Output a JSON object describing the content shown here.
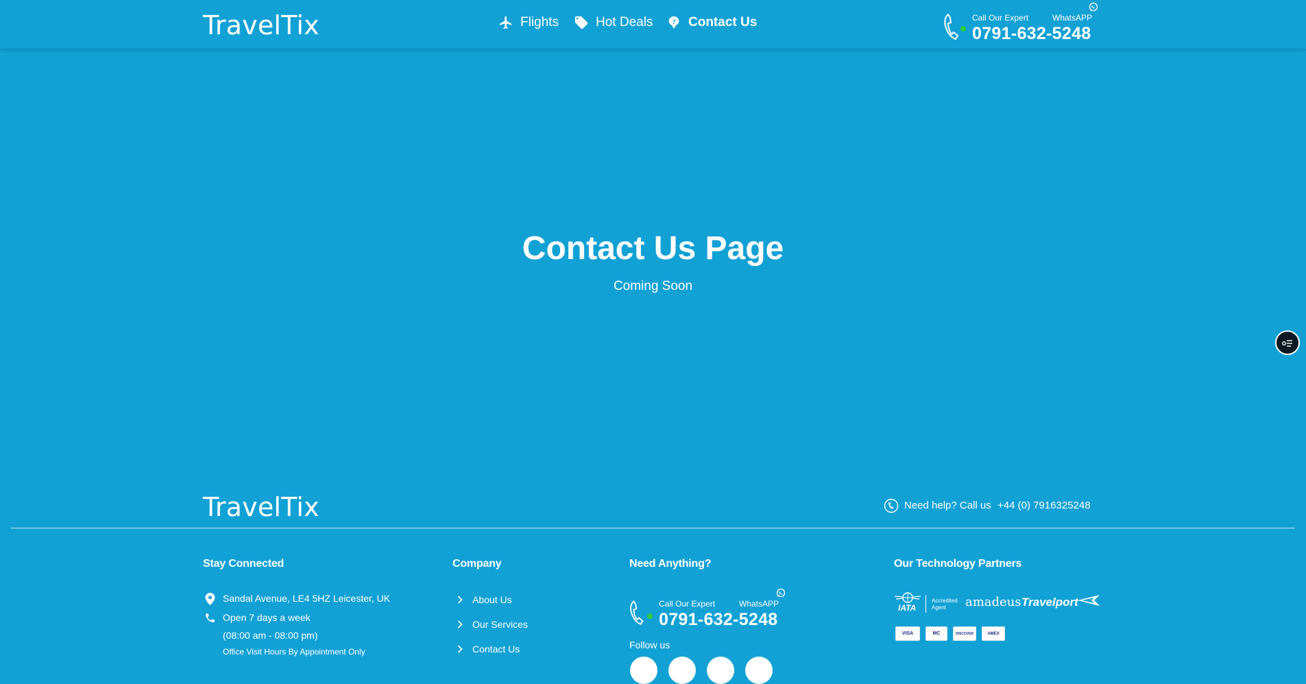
{
  "header": {
    "logo": "TravelTix",
    "nav": [
      {
        "label": "Flights",
        "icon": "airplane-icon"
      },
      {
        "label": "Hot Deals",
        "icon": "tag-icon"
      },
      {
        "label": "Contact Us",
        "icon": "question-bubble-icon",
        "active": true
      }
    ],
    "call_label": "Call Our Expert",
    "whatsapp_label": "WhatsAPP",
    "phone": "0791-632-5248"
  },
  "main": {
    "title": "Contact Us Page",
    "subtitle": "Coming Soon"
  },
  "footer": {
    "logo": "TravelTix",
    "help_label": "Need help? Call us",
    "help_phone": "+44 (0) 7916325248",
    "stay_connected": {
      "title": "Stay Connected",
      "address": "Sandal Avenue, LE4 5HZ Leicester, UK",
      "open": "Open 7 days a week",
      "hours": "(08:00 am - 08:00 pm)",
      "visit": "Office Visit Hours By Appointment Only"
    },
    "company": {
      "title": "Company",
      "links": [
        "About Us",
        "Our Services",
        "Contact Us"
      ]
    },
    "need_anything": {
      "title": "Need Anything?",
      "call_label": "Call Our Expert",
      "whatsapp_label": "WhatsAPP",
      "phone": "0791-632-5248",
      "follow": "Follow us"
    },
    "partners": {
      "title": "Our Technology Partners",
      "iata": "IATA",
      "accredited": "Accredited",
      "agent": "Agent",
      "amadeus": "amadeus",
      "travelport": "Travelport",
      "cards": [
        "VISA",
        "MC",
        "DISCOVER",
        "AMEX"
      ]
    }
  },
  "colors": {
    "background": "#12a1d5",
    "text": "#ffffff",
    "online_dot": "#2ecc40"
  }
}
